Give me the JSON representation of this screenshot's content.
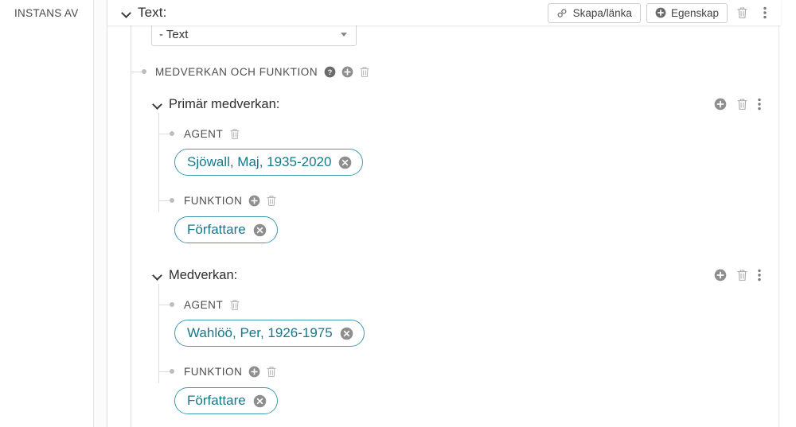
{
  "sidebar": {
    "label": "INSTANS AV"
  },
  "header": {
    "expand_icon": "chevron-down-icon",
    "title": "Text:",
    "create_link_label": "Skapa/länka",
    "create_link_icon": "link-icon",
    "property_label": "Egenskap",
    "property_icon": "plus-circle-icon",
    "delete_icon": "trash-icon",
    "more_icon": "kebab-menu-icon"
  },
  "select": {
    "value": "- Text",
    "caret_icon": "caret-down-icon"
  },
  "tree": {
    "root_node": {
      "label": "MEDVERKAN OCH FUNKTION",
      "icons": [
        "help-circle-icon",
        "plus-circle-icon",
        "trash-icon"
      ]
    },
    "sections": [
      {
        "title": "Primär medverkan:",
        "expand_icon": "chevron-down-icon",
        "actions": [
          "plus-circle-icon",
          "trash-icon",
          "kebab-menu-icon"
        ],
        "fields": [
          {
            "label": "AGENT",
            "icons": [
              "trash-icon"
            ],
            "chip": {
              "text": "Sjöwall, Maj, 1935-2020",
              "remove_icon": "remove-circle-icon"
            }
          },
          {
            "label": "FUNKTION",
            "icons": [
              "plus-circle-icon",
              "trash-icon"
            ],
            "chip": {
              "text": "Författare",
              "remove_icon": "remove-circle-icon"
            }
          }
        ]
      },
      {
        "title": "Medverkan:",
        "expand_icon": "chevron-down-icon",
        "actions": [
          "plus-circle-icon",
          "trash-icon",
          "kebab-menu-icon"
        ],
        "fields": [
          {
            "label": "AGENT",
            "icons": [
              "trash-icon"
            ],
            "chip": {
              "text": "Wahlöö, Per, 1926-1975",
              "remove_icon": "remove-circle-icon"
            }
          },
          {
            "label": "FUNKTION",
            "icons": [
              "plus-circle-icon",
              "trash-icon"
            ],
            "chip": {
              "text": "Författare",
              "remove_icon": "remove-circle-icon"
            }
          }
        ]
      }
    ]
  },
  "colors": {
    "chip_border": "#3f9cae",
    "chip_text": "#15798a",
    "icon_gray": "#9b9b9b",
    "icon_dark": "#7d7d7d",
    "tree_line": "#dcdcdc"
  }
}
